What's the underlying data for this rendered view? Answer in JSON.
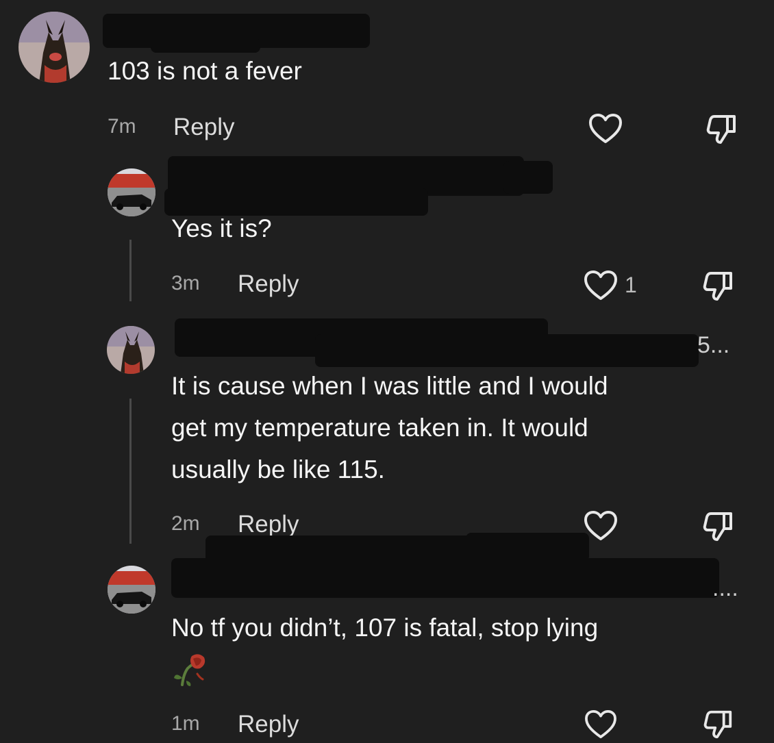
{
  "comments": [
    {
      "text": "103 is not a fever",
      "time": "7m",
      "reply_label": "Reply",
      "likes": "",
      "avatar": "dog-avatar"
    },
    {
      "text": "Yes it is?",
      "time": "3m",
      "reply_label": "Reply",
      "likes": "1",
      "avatar": "car-avatar"
    },
    {
      "name_tail": "5...",
      "text_lines": [
        "It is cause when I was little and I would",
        "get my temperature taken in. It would",
        "usually be like 115."
      ],
      "time": "2m",
      "reply_label": "Reply",
      "likes": "",
      "avatar": "dog-avatar"
    },
    {
      "name_tail": "....",
      "text": "No tf you didn’t, 107 is fatal, stop lying",
      "time": "1m",
      "reply_label": "Reply",
      "likes": "",
      "avatar": "car-avatar",
      "emoji": "wilted-rose"
    }
  ],
  "icons": {
    "like": "heart-outline-icon",
    "dislike": "thumbs-down-icon"
  },
  "colors": {
    "background": "#1f1f1f",
    "text": "#f5f5f5",
    "muted": "#a8a8a8",
    "thread_line": "#4a4a4a"
  }
}
